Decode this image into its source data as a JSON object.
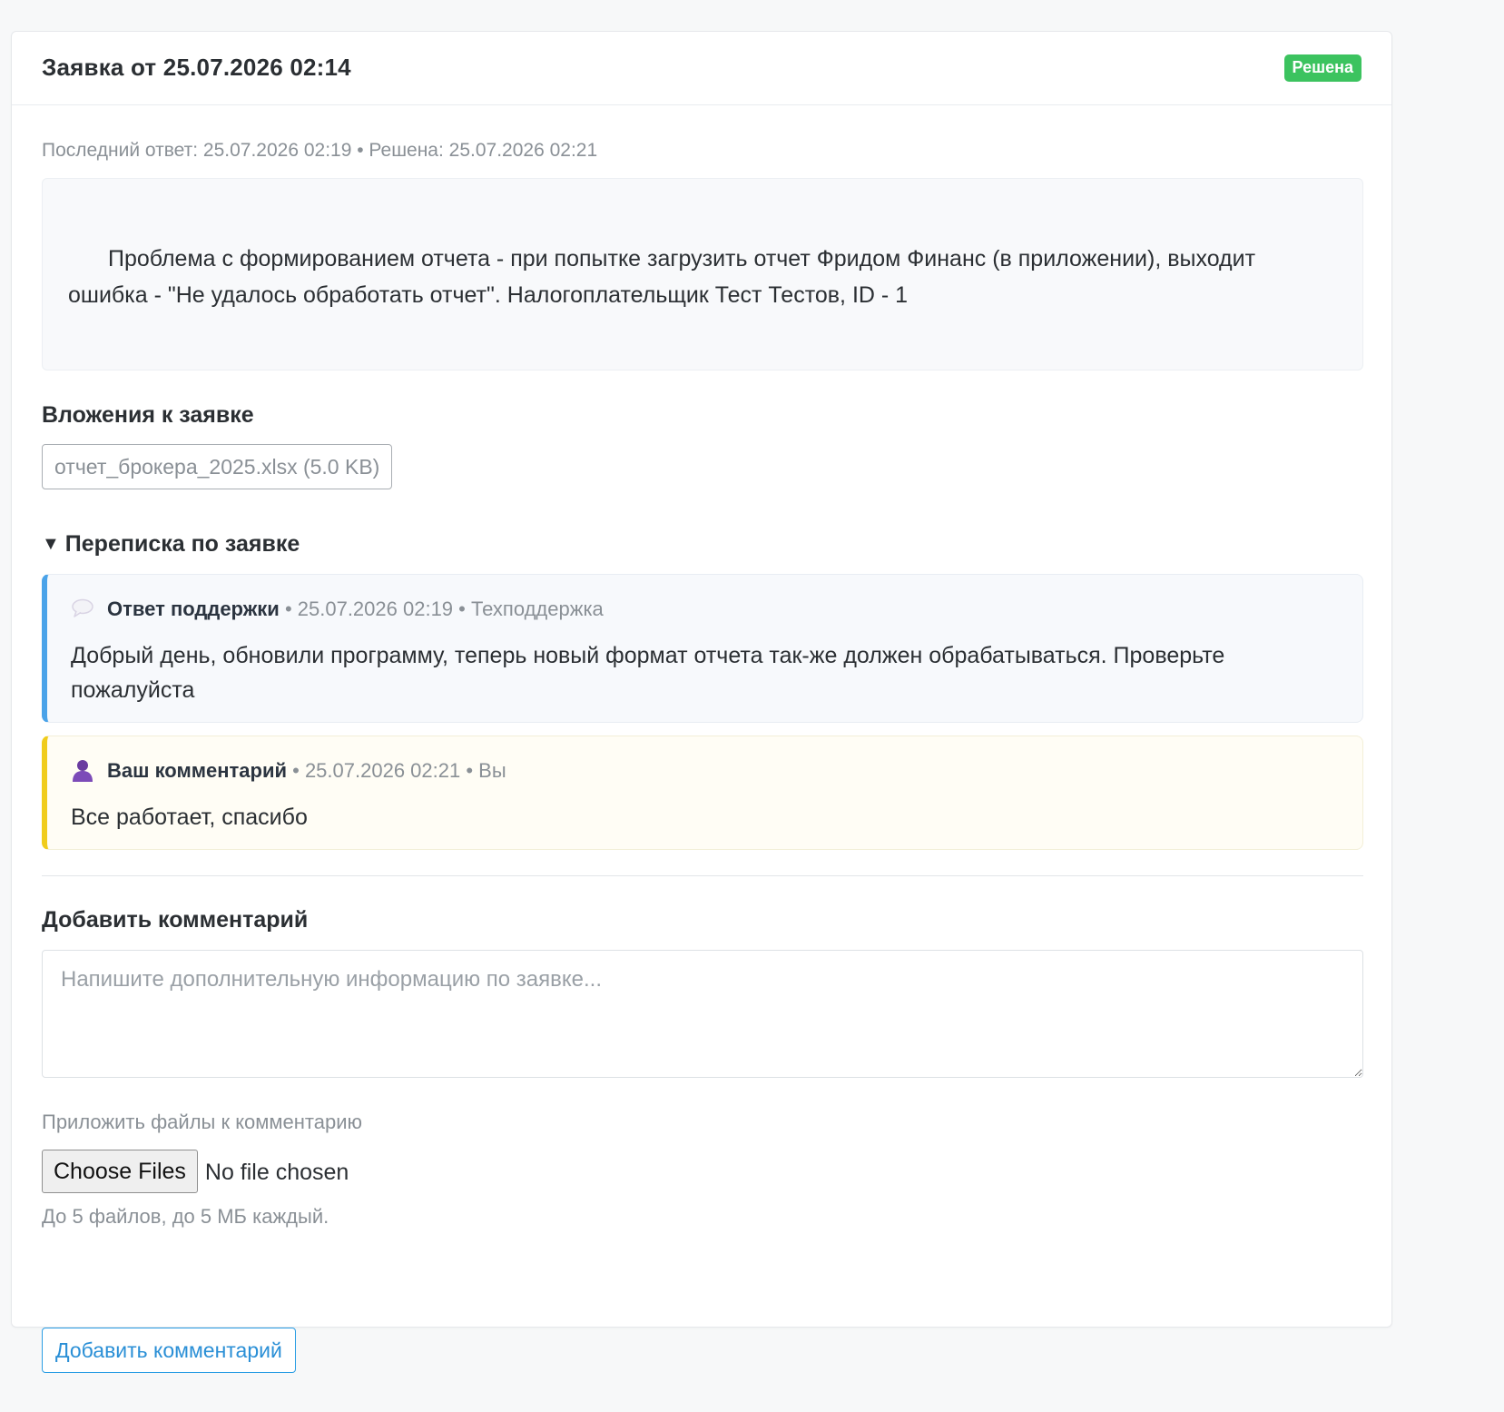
{
  "ticket": {
    "title": "Заявка от 25.07.2026 02:14",
    "status": "Решена",
    "status_color": "#3cc35f",
    "meta": "Последний ответ: 25.07.2026 02:19 • Решена: 25.07.2026 02:21",
    "description": "Проблема с формированием отчета - при попытке загрузить отчет Фридом Финанс (в приложении), выходит ошибка - \"Не удалось обработать отчет\". Налогоплательщик Тест Тестов, ID - 1"
  },
  "attachments": {
    "title": "Вложения к заявке",
    "items": [
      {
        "label": "отчет_брокера_2025.xlsx (5.0 KB)"
      }
    ]
  },
  "thread": {
    "toggle_label": "Переписка по заявке",
    "messages": [
      {
        "icon": "speech-bubble-icon",
        "author": "Ответ поддержки",
        "meta": " • 25.07.2026 02:19 • Техподдержка",
        "text": "Добрый день, обновили программу, теперь новый формат отчета так-же должен обрабатываться. Проверьте пожалуйста",
        "accent": "#4aa3e9"
      },
      {
        "icon": "user-icon",
        "author": "Ваш комментарий",
        "meta": " • 25.07.2026 02:21 • Вы",
        "text": "Все работает, спасибо",
        "accent": "#f0cc1c"
      }
    ]
  },
  "add_comment": {
    "title": "Добавить комментарий",
    "placeholder": "Напишите дополнительную информацию по заявке...",
    "files_label": "Приложить файлы к комментарию",
    "choose_files": "Choose Files",
    "no_file": "No file chosen",
    "hint": "До 5 файлов, до 5 МБ каждый.",
    "submit": "Добавить комментарий"
  }
}
